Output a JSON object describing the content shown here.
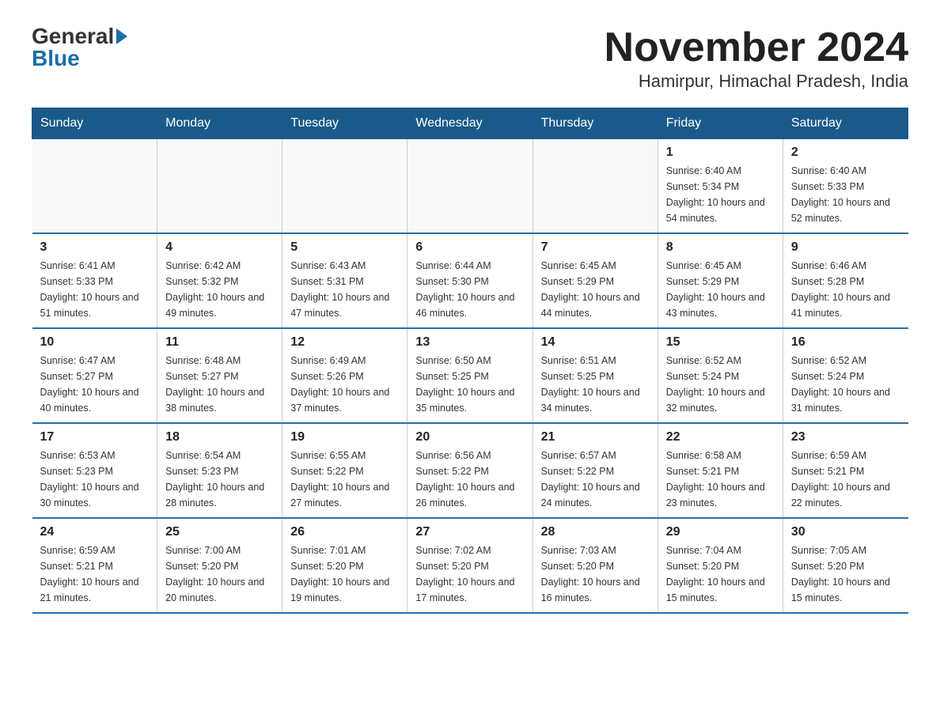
{
  "header": {
    "logo_general": "General",
    "logo_blue": "Blue",
    "title": "November 2024",
    "location": "Hamirpur, Himachal Pradesh, India"
  },
  "weekdays": [
    "Sunday",
    "Monday",
    "Tuesday",
    "Wednesday",
    "Thursday",
    "Friday",
    "Saturday"
  ],
  "weeks": [
    [
      {
        "day": "",
        "sunrise": "",
        "sunset": "",
        "daylight": ""
      },
      {
        "day": "",
        "sunrise": "",
        "sunset": "",
        "daylight": ""
      },
      {
        "day": "",
        "sunrise": "",
        "sunset": "",
        "daylight": ""
      },
      {
        "day": "",
        "sunrise": "",
        "sunset": "",
        "daylight": ""
      },
      {
        "day": "",
        "sunrise": "",
        "sunset": "",
        "daylight": ""
      },
      {
        "day": "1",
        "sunrise": "Sunrise: 6:40 AM",
        "sunset": "Sunset: 5:34 PM",
        "daylight": "Daylight: 10 hours and 54 minutes."
      },
      {
        "day": "2",
        "sunrise": "Sunrise: 6:40 AM",
        "sunset": "Sunset: 5:33 PM",
        "daylight": "Daylight: 10 hours and 52 minutes."
      }
    ],
    [
      {
        "day": "3",
        "sunrise": "Sunrise: 6:41 AM",
        "sunset": "Sunset: 5:33 PM",
        "daylight": "Daylight: 10 hours and 51 minutes."
      },
      {
        "day": "4",
        "sunrise": "Sunrise: 6:42 AM",
        "sunset": "Sunset: 5:32 PM",
        "daylight": "Daylight: 10 hours and 49 minutes."
      },
      {
        "day": "5",
        "sunrise": "Sunrise: 6:43 AM",
        "sunset": "Sunset: 5:31 PM",
        "daylight": "Daylight: 10 hours and 47 minutes."
      },
      {
        "day": "6",
        "sunrise": "Sunrise: 6:44 AM",
        "sunset": "Sunset: 5:30 PM",
        "daylight": "Daylight: 10 hours and 46 minutes."
      },
      {
        "day": "7",
        "sunrise": "Sunrise: 6:45 AM",
        "sunset": "Sunset: 5:29 PM",
        "daylight": "Daylight: 10 hours and 44 minutes."
      },
      {
        "day": "8",
        "sunrise": "Sunrise: 6:45 AM",
        "sunset": "Sunset: 5:29 PM",
        "daylight": "Daylight: 10 hours and 43 minutes."
      },
      {
        "day": "9",
        "sunrise": "Sunrise: 6:46 AM",
        "sunset": "Sunset: 5:28 PM",
        "daylight": "Daylight: 10 hours and 41 minutes."
      }
    ],
    [
      {
        "day": "10",
        "sunrise": "Sunrise: 6:47 AM",
        "sunset": "Sunset: 5:27 PM",
        "daylight": "Daylight: 10 hours and 40 minutes."
      },
      {
        "day": "11",
        "sunrise": "Sunrise: 6:48 AM",
        "sunset": "Sunset: 5:27 PM",
        "daylight": "Daylight: 10 hours and 38 minutes."
      },
      {
        "day": "12",
        "sunrise": "Sunrise: 6:49 AM",
        "sunset": "Sunset: 5:26 PM",
        "daylight": "Daylight: 10 hours and 37 minutes."
      },
      {
        "day": "13",
        "sunrise": "Sunrise: 6:50 AM",
        "sunset": "Sunset: 5:25 PM",
        "daylight": "Daylight: 10 hours and 35 minutes."
      },
      {
        "day": "14",
        "sunrise": "Sunrise: 6:51 AM",
        "sunset": "Sunset: 5:25 PM",
        "daylight": "Daylight: 10 hours and 34 minutes."
      },
      {
        "day": "15",
        "sunrise": "Sunrise: 6:52 AM",
        "sunset": "Sunset: 5:24 PM",
        "daylight": "Daylight: 10 hours and 32 minutes."
      },
      {
        "day": "16",
        "sunrise": "Sunrise: 6:52 AM",
        "sunset": "Sunset: 5:24 PM",
        "daylight": "Daylight: 10 hours and 31 minutes."
      }
    ],
    [
      {
        "day": "17",
        "sunrise": "Sunrise: 6:53 AM",
        "sunset": "Sunset: 5:23 PM",
        "daylight": "Daylight: 10 hours and 30 minutes."
      },
      {
        "day": "18",
        "sunrise": "Sunrise: 6:54 AM",
        "sunset": "Sunset: 5:23 PM",
        "daylight": "Daylight: 10 hours and 28 minutes."
      },
      {
        "day": "19",
        "sunrise": "Sunrise: 6:55 AM",
        "sunset": "Sunset: 5:22 PM",
        "daylight": "Daylight: 10 hours and 27 minutes."
      },
      {
        "day": "20",
        "sunrise": "Sunrise: 6:56 AM",
        "sunset": "Sunset: 5:22 PM",
        "daylight": "Daylight: 10 hours and 26 minutes."
      },
      {
        "day": "21",
        "sunrise": "Sunrise: 6:57 AM",
        "sunset": "Sunset: 5:22 PM",
        "daylight": "Daylight: 10 hours and 24 minutes."
      },
      {
        "day": "22",
        "sunrise": "Sunrise: 6:58 AM",
        "sunset": "Sunset: 5:21 PM",
        "daylight": "Daylight: 10 hours and 23 minutes."
      },
      {
        "day": "23",
        "sunrise": "Sunrise: 6:59 AM",
        "sunset": "Sunset: 5:21 PM",
        "daylight": "Daylight: 10 hours and 22 minutes."
      }
    ],
    [
      {
        "day": "24",
        "sunrise": "Sunrise: 6:59 AM",
        "sunset": "Sunset: 5:21 PM",
        "daylight": "Daylight: 10 hours and 21 minutes."
      },
      {
        "day": "25",
        "sunrise": "Sunrise: 7:00 AM",
        "sunset": "Sunset: 5:20 PM",
        "daylight": "Daylight: 10 hours and 20 minutes."
      },
      {
        "day": "26",
        "sunrise": "Sunrise: 7:01 AM",
        "sunset": "Sunset: 5:20 PM",
        "daylight": "Daylight: 10 hours and 19 minutes."
      },
      {
        "day": "27",
        "sunrise": "Sunrise: 7:02 AM",
        "sunset": "Sunset: 5:20 PM",
        "daylight": "Daylight: 10 hours and 17 minutes."
      },
      {
        "day": "28",
        "sunrise": "Sunrise: 7:03 AM",
        "sunset": "Sunset: 5:20 PM",
        "daylight": "Daylight: 10 hours and 16 minutes."
      },
      {
        "day": "29",
        "sunrise": "Sunrise: 7:04 AM",
        "sunset": "Sunset: 5:20 PM",
        "daylight": "Daylight: 10 hours and 15 minutes."
      },
      {
        "day": "30",
        "sunrise": "Sunrise: 7:05 AM",
        "sunset": "Sunset: 5:20 PM",
        "daylight": "Daylight: 10 hours and 15 minutes."
      }
    ]
  ]
}
